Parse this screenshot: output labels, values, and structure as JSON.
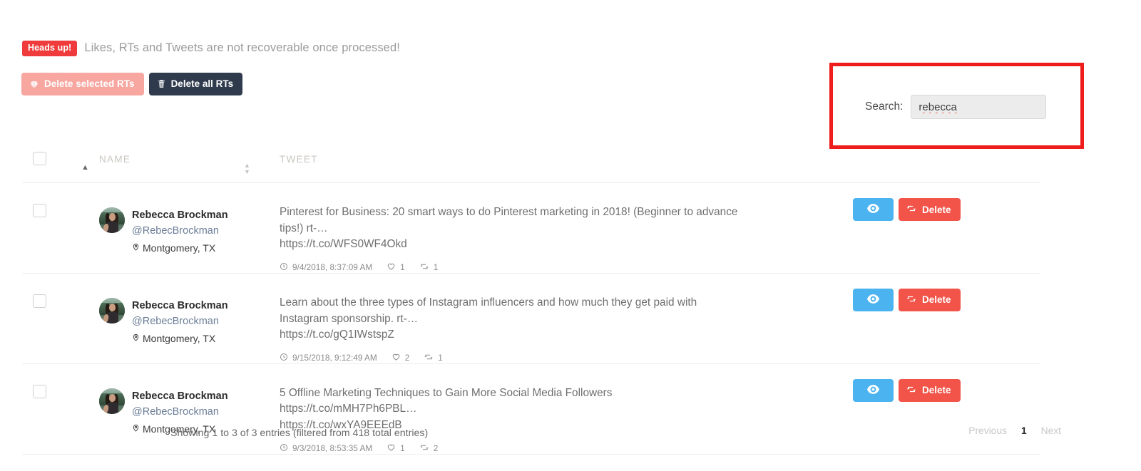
{
  "alert": {
    "badge": "Heads up!",
    "message": "Likes, RTs and Tweets are not recoverable once processed!"
  },
  "toolbar": {
    "delete_selected_label": "Delete selected RTs",
    "delete_all_label": "Delete all RTs"
  },
  "search": {
    "label": "Search:",
    "value": "rebecca",
    "placeholder": ""
  },
  "table": {
    "headers": {
      "name": "NAME",
      "tweet": "TWEET"
    },
    "rows": [
      {
        "name": "Rebecca Brockman",
        "handle": "@RebecBrockman",
        "location": "Montgomery, TX",
        "text": "Pinterest for Business: 20 smart ways to do Pinterest marketing in 2018! (Beginner to advance tips!) rt-…",
        "url": "https://t.co/WFS0WF4Okd",
        "date": "9/4/2018, 8:37:09 AM",
        "likes": "1",
        "retweets": "1",
        "view_label": "",
        "delete_label": "Delete"
      },
      {
        "name": "Rebecca Brockman",
        "handle": "@RebecBrockman",
        "location": "Montgomery, TX",
        "text": "Learn about the three types of Instagram influencers and how much they get paid with Instagram sponsorship. rt-…",
        "url": "https://t.co/gQ1IWstspZ",
        "date": "9/15/2018, 9:12:49 AM",
        "likes": "2",
        "retweets": "1",
        "view_label": "",
        "delete_label": "Delete"
      },
      {
        "name": "Rebecca Brockman",
        "handle": "@RebecBrockman",
        "location": "Montgomery, TX",
        "text": "5 Offline Marketing Techniques to Gain More Social Media Followers https://t.co/mMH7Ph6PBL…",
        "url": "https://t.co/wxYA9EEEdB",
        "date": "9/3/2018, 8:53:35 AM",
        "likes": "1",
        "retweets": "2",
        "view_label": "",
        "delete_label": "Delete"
      }
    ]
  },
  "footer": {
    "info": "Showing 1 to 3 of 3 entries (filtered from 418 total entries)",
    "previous": "Previous",
    "current_page": "1",
    "next": "Next"
  },
  "colors": {
    "alert_badge": "#ef3b3b",
    "delete_selected": "#f7a6a0",
    "delete_all": "#2f3b4c",
    "view_button": "#4bb3f0",
    "delete_button": "#f25449",
    "annotation": "#ef1c1c"
  }
}
